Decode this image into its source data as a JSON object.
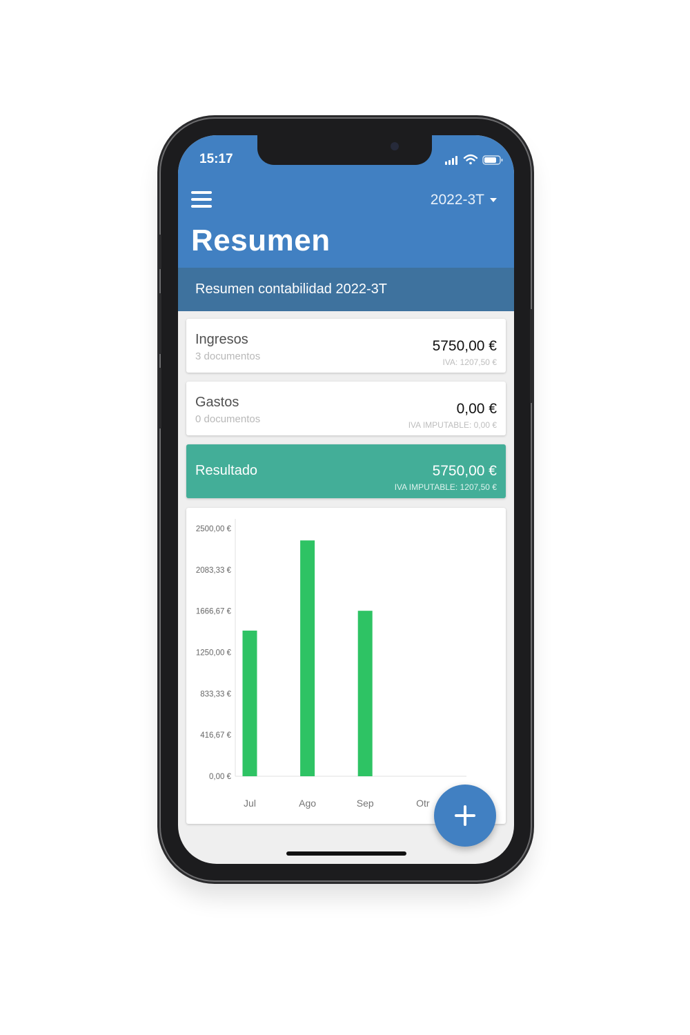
{
  "status_bar": {
    "time": "15:17"
  },
  "header": {
    "period": "2022-3T",
    "title": "Resumen"
  },
  "subheader": {
    "text": "Resumen contabilidad 2022-3T"
  },
  "cards": {
    "ingresos": {
      "title": "Ingresos",
      "sub": "3 documentos",
      "amount": "5750,00 €",
      "note": "IVA: 1207,50 €"
    },
    "gastos": {
      "title": "Gastos",
      "sub": "0 documentos",
      "amount": "0,00 €",
      "note": "IVA IMPUTABLE: 0,00 €"
    },
    "resultado": {
      "title": "Resultado",
      "amount": "5750,00 €",
      "note": "IVA IMPUTABLE: 1207,50 €"
    }
  },
  "colors": {
    "header": "#4180c2",
    "subheader": "#3e729e",
    "result": "#43ae98",
    "bar": "#2ec364"
  },
  "icons": {
    "menu": "menu-icon",
    "fab": "plus-icon",
    "dropdown": "caret-down-icon"
  },
  "chart_data": {
    "type": "bar",
    "categories": [
      "Jul",
      "Ago",
      "Sep",
      "Otr"
    ],
    "values": [
      1470,
      2380,
      1670,
      0
    ],
    "ylim": [
      0,
      2500
    ],
    "yticks": [
      0,
      416.67,
      833.33,
      1250,
      1666.67,
      2083.33,
      2500
    ],
    "ytick_labels": [
      "0,00 €",
      "416,67 €",
      "833,33 €",
      "1250,00 €",
      "1666,67 €",
      "2083,33 €",
      "2500,00 €"
    ],
    "grid": false,
    "legend": "none"
  }
}
